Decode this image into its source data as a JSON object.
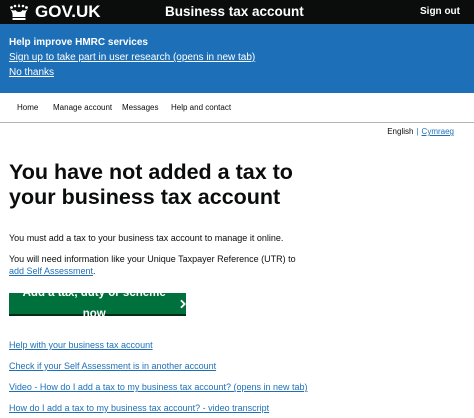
{
  "header": {
    "brand": "GOV.UK",
    "service_name": "Business tax account",
    "sign_out": "Sign out"
  },
  "banner": {
    "title": "Help improve HMRC services",
    "research_link": "Sign up to take part in user research (opens in new tab)",
    "no_thanks": "No thanks"
  },
  "nav": {
    "items": [
      "Home",
      "Manage account",
      "Messages",
      "Help and contact"
    ]
  },
  "language": {
    "current": "English",
    "separator": "|",
    "other": "Cymraeg"
  },
  "main": {
    "title": "You have not added a tax to your business tax account",
    "para1": "You must add a tax to your business tax account to manage it online.",
    "para2_prefix": "You will need information like your Unique Taxpayer Reference (UTR) to ",
    "para2_link": "add Self Assessment",
    "para2_suffix": ".",
    "start_button": "Add a tax, duty or scheme now",
    "links": [
      "Help with your business tax account",
      "Check if your Self Assessment is in another account",
      "Video - How do I add a tax to my business tax account? (opens in new tab)",
      "How do I add a tax to my business tax account? - video transcript"
    ]
  },
  "colors": {
    "header_bg": "#0b0c0c",
    "banner_bg": "#1d70b8",
    "link": "#1d70b8",
    "button_green": "#00703c",
    "text": "#0b0c0c"
  },
  "icons": {
    "crown": "crown-icon",
    "start_arrow": "chevron-right-icon"
  }
}
